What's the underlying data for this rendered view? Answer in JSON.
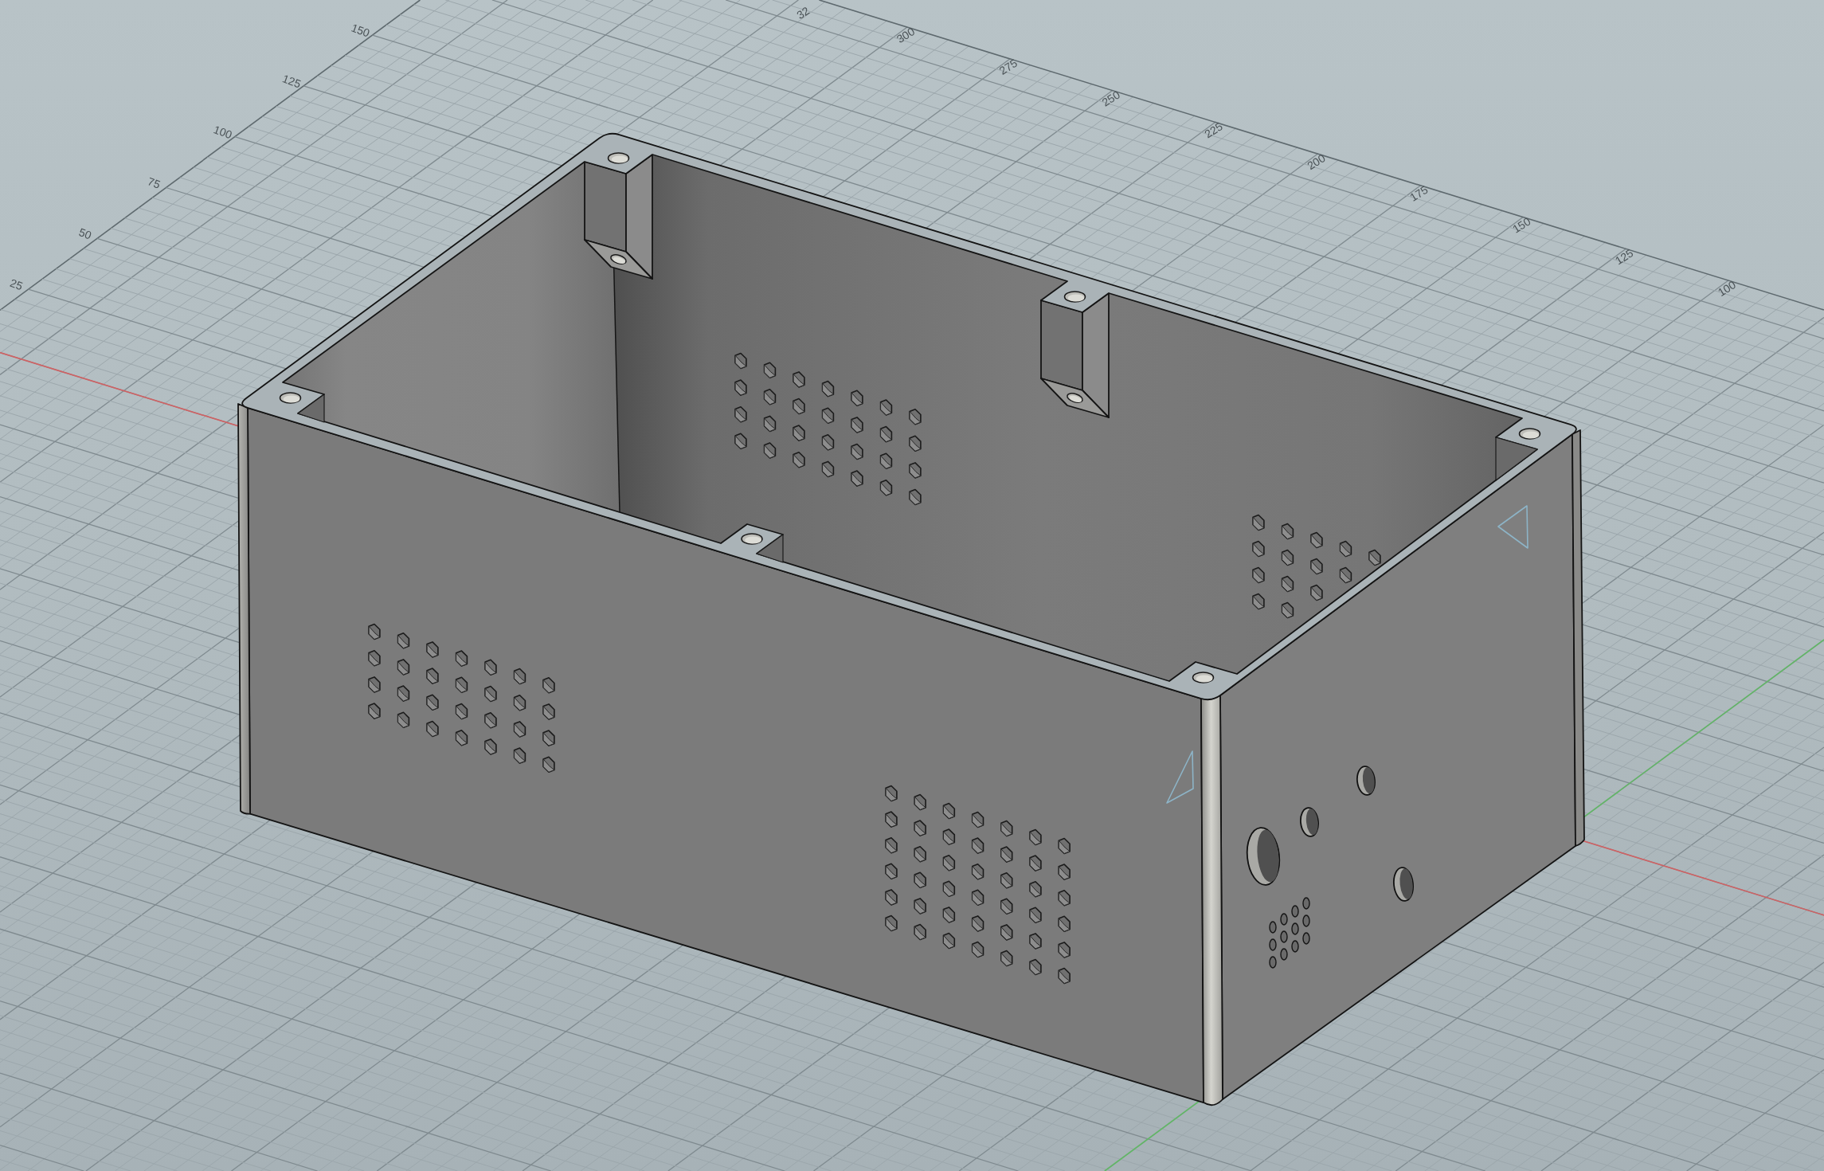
{
  "viewport": {
    "side_ruler_labels": [
      "150",
      "125",
      "100",
      "75",
      "50",
      "25"
    ],
    "top_ruler_labels": [
      "32",
      "300",
      "275",
      "250",
      "225",
      "200",
      "175",
      "150",
      "125",
      "100"
    ]
  }
}
